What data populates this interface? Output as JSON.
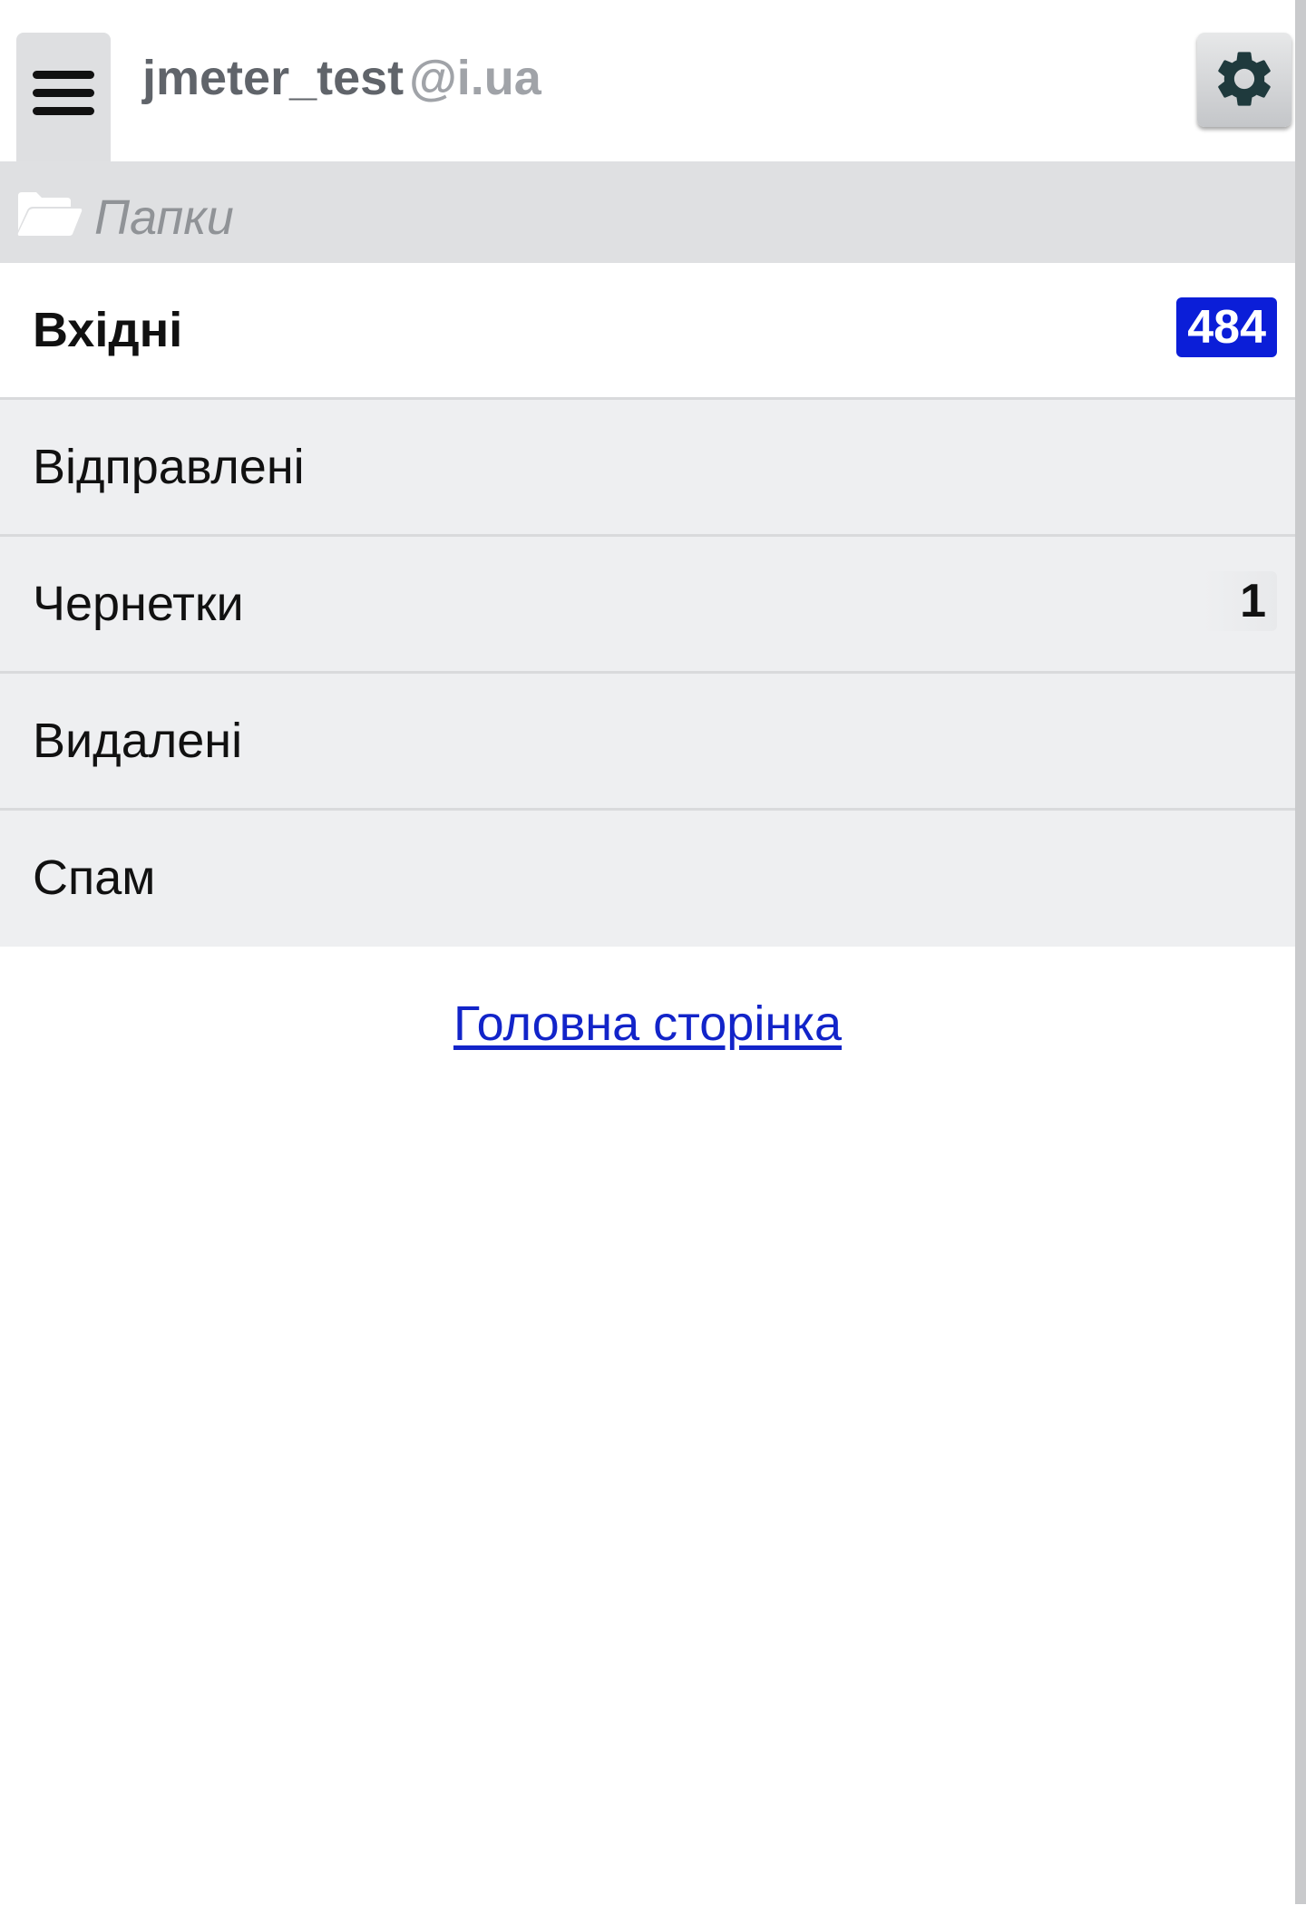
{
  "header": {
    "account_user": "jmeter_test",
    "account_domain": "@i.ua",
    "menu_icon": "hamburger-menu-icon",
    "settings_icon": "gear-icon"
  },
  "folders_section": {
    "title": "Папки",
    "icon": "open-folder-icon"
  },
  "folders": [
    {
      "label": "Вхідні",
      "badge": "484",
      "badge_style": "unread"
    },
    {
      "label": "Відправлені",
      "badge": ""
    },
    {
      "label": "Чернетки",
      "badge": "1",
      "badge_style": "count"
    },
    {
      "label": "Видалені",
      "badge": ""
    },
    {
      "label": "Спам",
      "badge": ""
    }
  ],
  "footer": {
    "home_link": "Головна сторінка"
  },
  "colors": {
    "unread_badge": "#0b1ed8",
    "link": "#1224c9",
    "folder_header_bg": "#dfe0e2",
    "row_bg": "#eeeff1"
  }
}
